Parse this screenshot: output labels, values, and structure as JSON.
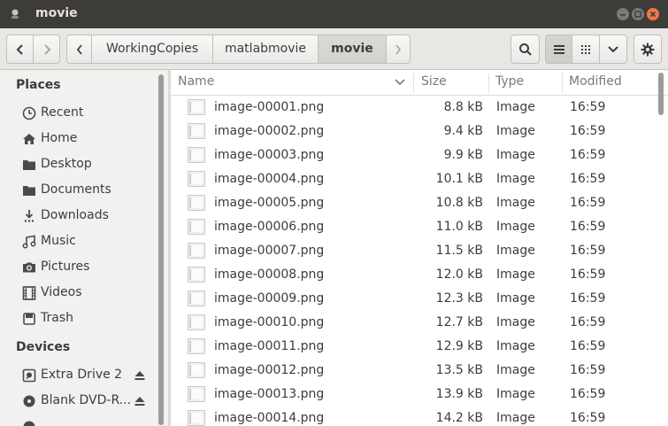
{
  "window": {
    "title": "movie"
  },
  "breadcrumb": [
    "WorkingCopies",
    "matlabmovie",
    "movie"
  ],
  "sidebar": {
    "sections": [
      {
        "heading": "Places"
      },
      {
        "heading": "Devices"
      }
    ],
    "places": [
      {
        "label": "Recent",
        "icon": "recent-icon"
      },
      {
        "label": "Home",
        "icon": "home-icon"
      },
      {
        "label": "Desktop",
        "icon": "desktop-icon"
      },
      {
        "label": "Documents",
        "icon": "documents-icon"
      },
      {
        "label": "Downloads",
        "icon": "downloads-icon"
      },
      {
        "label": "Music",
        "icon": "music-icon"
      },
      {
        "label": "Pictures",
        "icon": "pictures-icon"
      },
      {
        "label": "Videos",
        "icon": "videos-icon"
      },
      {
        "label": "Trash",
        "icon": "trash-icon"
      }
    ],
    "devices": [
      {
        "label": "Extra Drive 2",
        "icon": "drive-icon",
        "eject": true
      },
      {
        "label": "Blank DVD-R...",
        "icon": "disc-icon",
        "eject": true
      }
    ]
  },
  "columns": {
    "name": "Name",
    "size": "Size",
    "type": "Type",
    "modified": "Modified"
  },
  "files": [
    {
      "name": "image-00001.png",
      "size": "8.8 kB",
      "type": "Image",
      "modified": "16:59"
    },
    {
      "name": "image-00002.png",
      "size": "9.4 kB",
      "type": "Image",
      "modified": "16:59"
    },
    {
      "name": "image-00003.png",
      "size": "9.9 kB",
      "type": "Image",
      "modified": "16:59"
    },
    {
      "name": "image-00004.png",
      "size": "10.1 kB",
      "type": "Image",
      "modified": "16:59"
    },
    {
      "name": "image-00005.png",
      "size": "10.8 kB",
      "type": "Image",
      "modified": "16:59"
    },
    {
      "name": "image-00006.png",
      "size": "11.0 kB",
      "type": "Image",
      "modified": "16:59"
    },
    {
      "name": "image-00007.png",
      "size": "11.5 kB",
      "type": "Image",
      "modified": "16:59"
    },
    {
      "name": "image-00008.png",
      "size": "12.0 kB",
      "type": "Image",
      "modified": "16:59"
    },
    {
      "name": "image-00009.png",
      "size": "12.3 kB",
      "type": "Image",
      "modified": "16:59"
    },
    {
      "name": "image-00010.png",
      "size": "12.7 kB",
      "type": "Image",
      "modified": "16:59"
    },
    {
      "name": "image-00011.png",
      "size": "12.9 kB",
      "type": "Image",
      "modified": "16:59"
    },
    {
      "name": "image-00012.png",
      "size": "13.5 kB",
      "type": "Image",
      "modified": "16:59"
    },
    {
      "name": "image-00013.png",
      "size": "13.9 kB",
      "type": "Image",
      "modified": "16:59"
    },
    {
      "name": "image-00014.png",
      "size": "14.2 kB",
      "type": "Image",
      "modified": "16:59"
    }
  ],
  "colors": {
    "titlebar": "#3d3c38",
    "close": "#f07746",
    "accent": "#e6e2da"
  }
}
